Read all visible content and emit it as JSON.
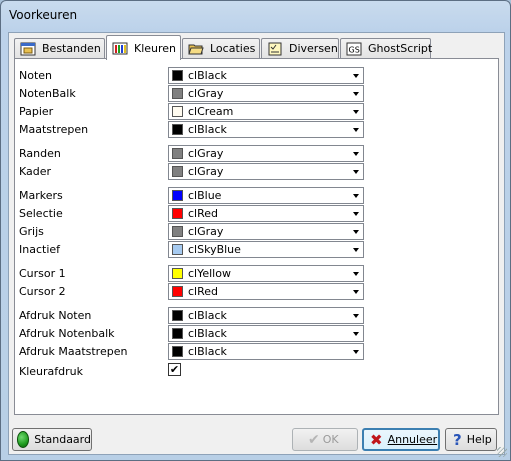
{
  "window": {
    "title": "Voorkeuren"
  },
  "tabs": [
    {
      "label": "Bestanden",
      "icon": "folder-window-icon"
    },
    {
      "label": "Kleuren",
      "icon": "color-bars-icon"
    },
    {
      "label": "Locaties",
      "icon": "open-folder-icon"
    },
    {
      "label": "Diversen",
      "icon": "checklist-icon"
    },
    {
      "label": "GhostScript",
      "icon": "ghostscript-icon"
    }
  ],
  "active_tab": "Kleuren",
  "colors": {
    "noten": {
      "label": "Noten",
      "value": "clBlack",
      "swatch": "#000000"
    },
    "notenbalk": {
      "label": "NotenBalk",
      "value": "clGray",
      "swatch": "#808080"
    },
    "papier": {
      "label": "Papier",
      "value": "clCream",
      "swatch": "#fffbf0"
    },
    "maatstrepen": {
      "label": "Maatstrepen",
      "value": "clBlack",
      "swatch": "#000000"
    },
    "randen": {
      "label": "Randen",
      "value": "clGray",
      "swatch": "#808080"
    },
    "kader": {
      "label": "Kader",
      "value": "clGray",
      "swatch": "#808080"
    },
    "markers": {
      "label": "Markers",
      "value": "clBlue",
      "swatch": "#0000ff"
    },
    "selectie": {
      "label": "Selectie",
      "value": "clRed",
      "swatch": "#ff0000"
    },
    "grijs": {
      "label": "Grijs",
      "value": "clGray",
      "swatch": "#808080"
    },
    "inactief": {
      "label": "Inactief",
      "value": "clSkyBlue",
      "swatch": "#a6caf0"
    },
    "cursor1": {
      "label": "Cursor 1",
      "value": "clYellow",
      "swatch": "#ffff00"
    },
    "cursor2": {
      "label": "Cursor 2",
      "value": "clRed",
      "swatch": "#ff0000"
    },
    "afdruk_noten": {
      "label": "Afdruk Noten",
      "value": "clBlack",
      "swatch": "#000000"
    },
    "afdruk_notenbalk": {
      "label": "Afdruk Notenbalk",
      "value": "clBlack",
      "swatch": "#000000"
    },
    "afdruk_maatstrepen": {
      "label": "Afdruk Maatstrepen",
      "value": "clBlack",
      "swatch": "#000000"
    }
  },
  "kleurafdruk": {
    "label": "Kleurafdruk",
    "checked": true,
    "mark": "✔"
  },
  "buttons": {
    "standaard": "Standaard",
    "ok": "OK",
    "annuleer": "Annuleer",
    "help": "Help"
  },
  "accent_colors": {
    "standaard_icon": "#1f9d1f",
    "annuleer_icon": "#c0151b",
    "help_icon": "#2a55b8"
  }
}
